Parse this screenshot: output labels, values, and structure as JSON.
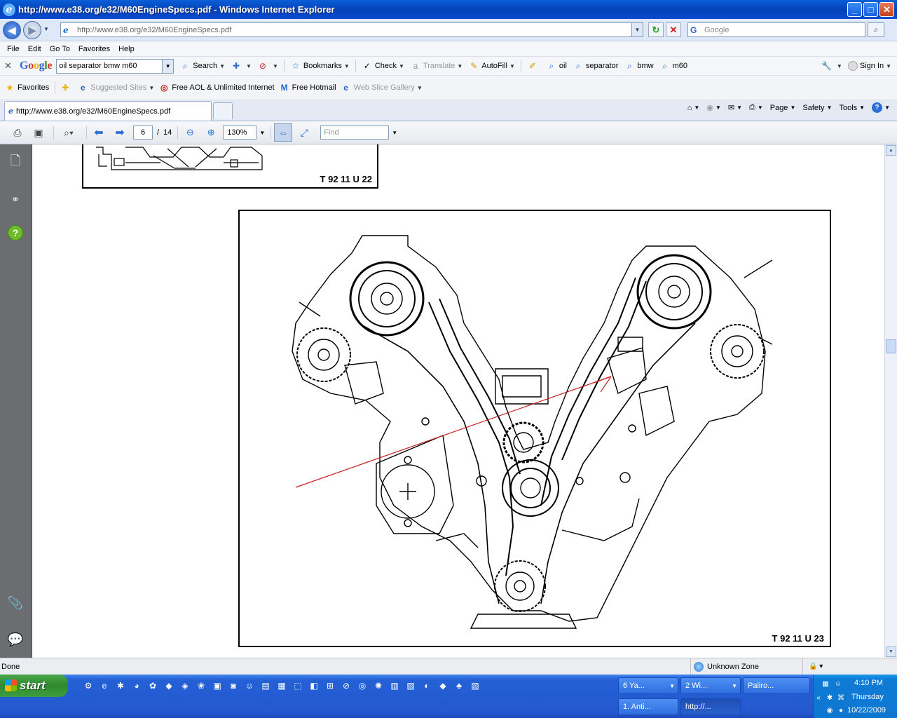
{
  "window": {
    "title": "http://www.e38.org/e32/M60EngineSpecs.pdf - Windows Internet Explorer",
    "min": "_",
    "max": "□",
    "close": "✕"
  },
  "address": {
    "url": "http://www.e38.org/e32/M60EngineSpecs.pdf",
    "search_placeholder": "Google",
    "back": "◀",
    "forward": "▶",
    "refresh": "↻",
    "stop": "✕",
    "search_btn": "⌕"
  },
  "menu": [
    "File",
    "Edit",
    "Go To",
    "Favorites",
    "Help"
  ],
  "google_toolbar": {
    "logo": "Google",
    "query": "oil separator bmw m60",
    "items": [
      {
        "icon": "search-icon",
        "label": "Search",
        "dropdown": true,
        "dim": false
      },
      {
        "icon": "plus-icon",
        "label": "",
        "dropdown": true,
        "dim": false
      },
      {
        "icon": "popup-blocker-icon",
        "label": "",
        "dropdown": true,
        "dim": false
      },
      {
        "icon": "star-icon",
        "label": "Bookmarks",
        "dropdown": true,
        "dim": false
      },
      {
        "icon": "spellcheck-icon",
        "label": "Check",
        "dropdown": true,
        "dim": false
      },
      {
        "icon": "translate-icon",
        "label": "Translate",
        "dropdown": true,
        "dim": true
      },
      {
        "icon": "autofill-icon",
        "label": "AutoFill",
        "dropdown": true,
        "dim": false
      },
      {
        "icon": "highlighter-icon",
        "label": "",
        "dropdown": false,
        "dim": false
      },
      {
        "icon": "search-term-icon",
        "label": "oil",
        "dropdown": false,
        "dim": false
      },
      {
        "icon": "search-term-icon",
        "label": "separator",
        "dropdown": false,
        "dim": false
      },
      {
        "icon": "search-term-icon",
        "label": "bmw",
        "dropdown": false,
        "dim": false
      },
      {
        "icon": "search-term-icon",
        "label": "m60",
        "dropdown": false,
        "dim": false
      }
    ],
    "sign_in": "Sign In"
  },
  "favorites_bar": {
    "favorites": "Favorites",
    "items": [
      {
        "label": "Suggested Sites",
        "dim": true,
        "dropdown": true
      },
      {
        "label": "Free AOL & Unlimited Internet",
        "dim": false,
        "dropdown": false
      },
      {
        "label": "Free Hotmail",
        "dim": false,
        "dropdown": false
      },
      {
        "label": "Web Slice Gallery",
        "dim": true,
        "dropdown": true
      }
    ]
  },
  "tab": {
    "label": "http://www.e38.org/e32/M60EngineSpecs.pdf"
  },
  "command_bar": {
    "page": "Page",
    "safety": "Safety",
    "tools": "Tools"
  },
  "pdf_toolbar": {
    "page_current": "6",
    "page_sep": "/",
    "page_total": "14",
    "zoom": "130%",
    "find_placeholder": "Find"
  },
  "document": {
    "figure1_caption": "T 92 11 U 22",
    "figure2_caption": "T 92 11 U 23"
  },
  "status": {
    "text": "Done",
    "zone": "Unknown Zone"
  },
  "taskbar": {
    "start": "start",
    "buttons": [
      {
        "label": "6 Ya...",
        "row": 1
      },
      {
        "label": "2 Wi...",
        "row": 1
      },
      {
        "label": "Paliro...",
        "row": 1
      },
      {
        "label": "1. Anti...",
        "row": 2
      },
      {
        "label": "http://...",
        "row": 2
      }
    ],
    "time": "4:10 PM",
    "day": "Thursday",
    "date": "10/22/2009"
  }
}
